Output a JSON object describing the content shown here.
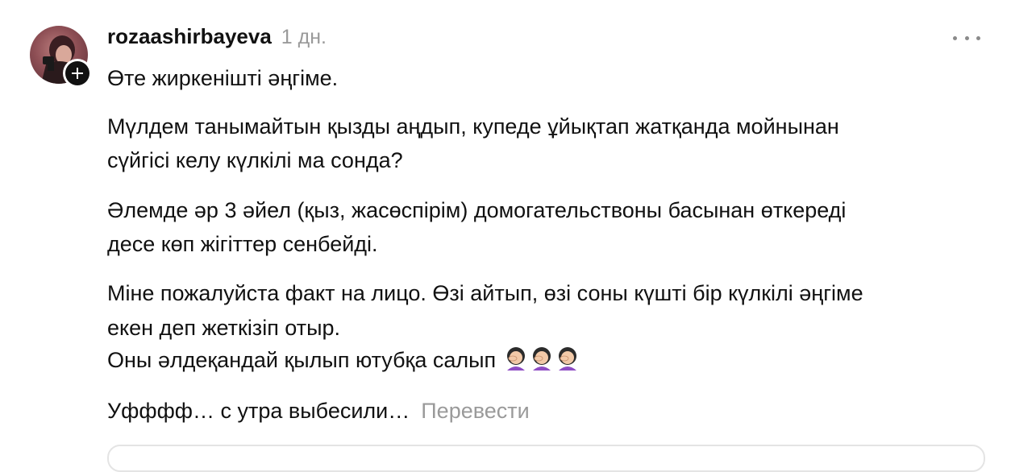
{
  "comment": {
    "username": "rozaashirbayeva",
    "timestamp": "1 дн.",
    "more_icon": "ellipsis-icon",
    "follow_icon": "plus-icon",
    "paragraphs": {
      "p1": "Өте жиркеніштi әңгiме.",
      "p2_line1": "Мүлдем танымайтын қызды аңдып, купеде ұйықтап жатқанда мойнынан",
      "p2_line2": "сүйгiсi келу күлкiлi ма сонда?",
      "p3_line1": "Әлемде әр 3 әйел (қыз, жасөспiрiм) домогательствоны басынан өткередi",
      "p3_line2": "десе көп жiгiттер сенбейдi.",
      "p4_line1": "Мiне пожалуйста факт на лицо. Өзi айтып, өзi соны күштi бiр күлкiлi әңгiме",
      "p4_line2": "екен деп жеткiзiп отыр.",
      "p4_line3": "Оны әлдеқандай қылып ютубқа салып",
      "p5": "Уфффф… с утра выбесили…"
    },
    "emoji_name": "woman-facepalming-icon",
    "emoji_count": 3,
    "translate_label": "Перевести"
  }
}
